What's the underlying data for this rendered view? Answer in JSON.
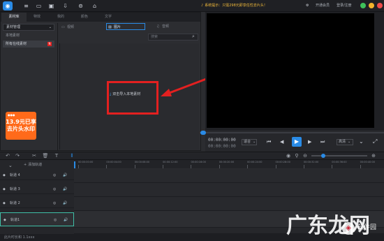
{
  "titlebar": {
    "notice": "系统提示：只需298元即享任性去片头！",
    "open_member": "开通会员",
    "login": "登录/注册"
  },
  "library": {
    "tabs": [
      "素材库",
      "特效",
      "我的",
      "颜色",
      "文字"
    ],
    "category": "素材管理",
    "categories": [
      "本地素材",
      "所有在线素材"
    ],
    "filters": [
      "视频",
      "图片",
      "音频"
    ],
    "search_placeholder": "搜索",
    "import_label": "双击导入本地素材",
    "ad_line1": "13.9元已享",
    "ad_line2": "去片头水印"
  },
  "preview": {
    "timecode_current": "00:00:00:00",
    "timecode_total": "00:00:00:00",
    "fit_label": "适合",
    "quality_label": "高清"
  },
  "timeline": {
    "add_track": "添加轨道",
    "ruler_labels": [
      "00:00:00:00",
      "00:00:04:00",
      "00:00:08:00",
      "00:00:12:00",
      "00:00:16:00",
      "00:00:20:00",
      "00:00:24:00",
      "00:00:28:00",
      "00:00:32:00",
      "00:00:36:00",
      "00:00:40:00"
    ],
    "tracks": [
      "轨道 4",
      "轨道 3",
      "轨道 2",
      "轨道1"
    ]
  },
  "status": {
    "text": "此片时长和 1.1xxx"
  },
  "watermark": {
    "main": "广东龙网",
    "sub": "软件园"
  },
  "colors": {
    "accent": "#2a8be6",
    "highlight": "#e32020",
    "notice": "#f0b93a"
  }
}
